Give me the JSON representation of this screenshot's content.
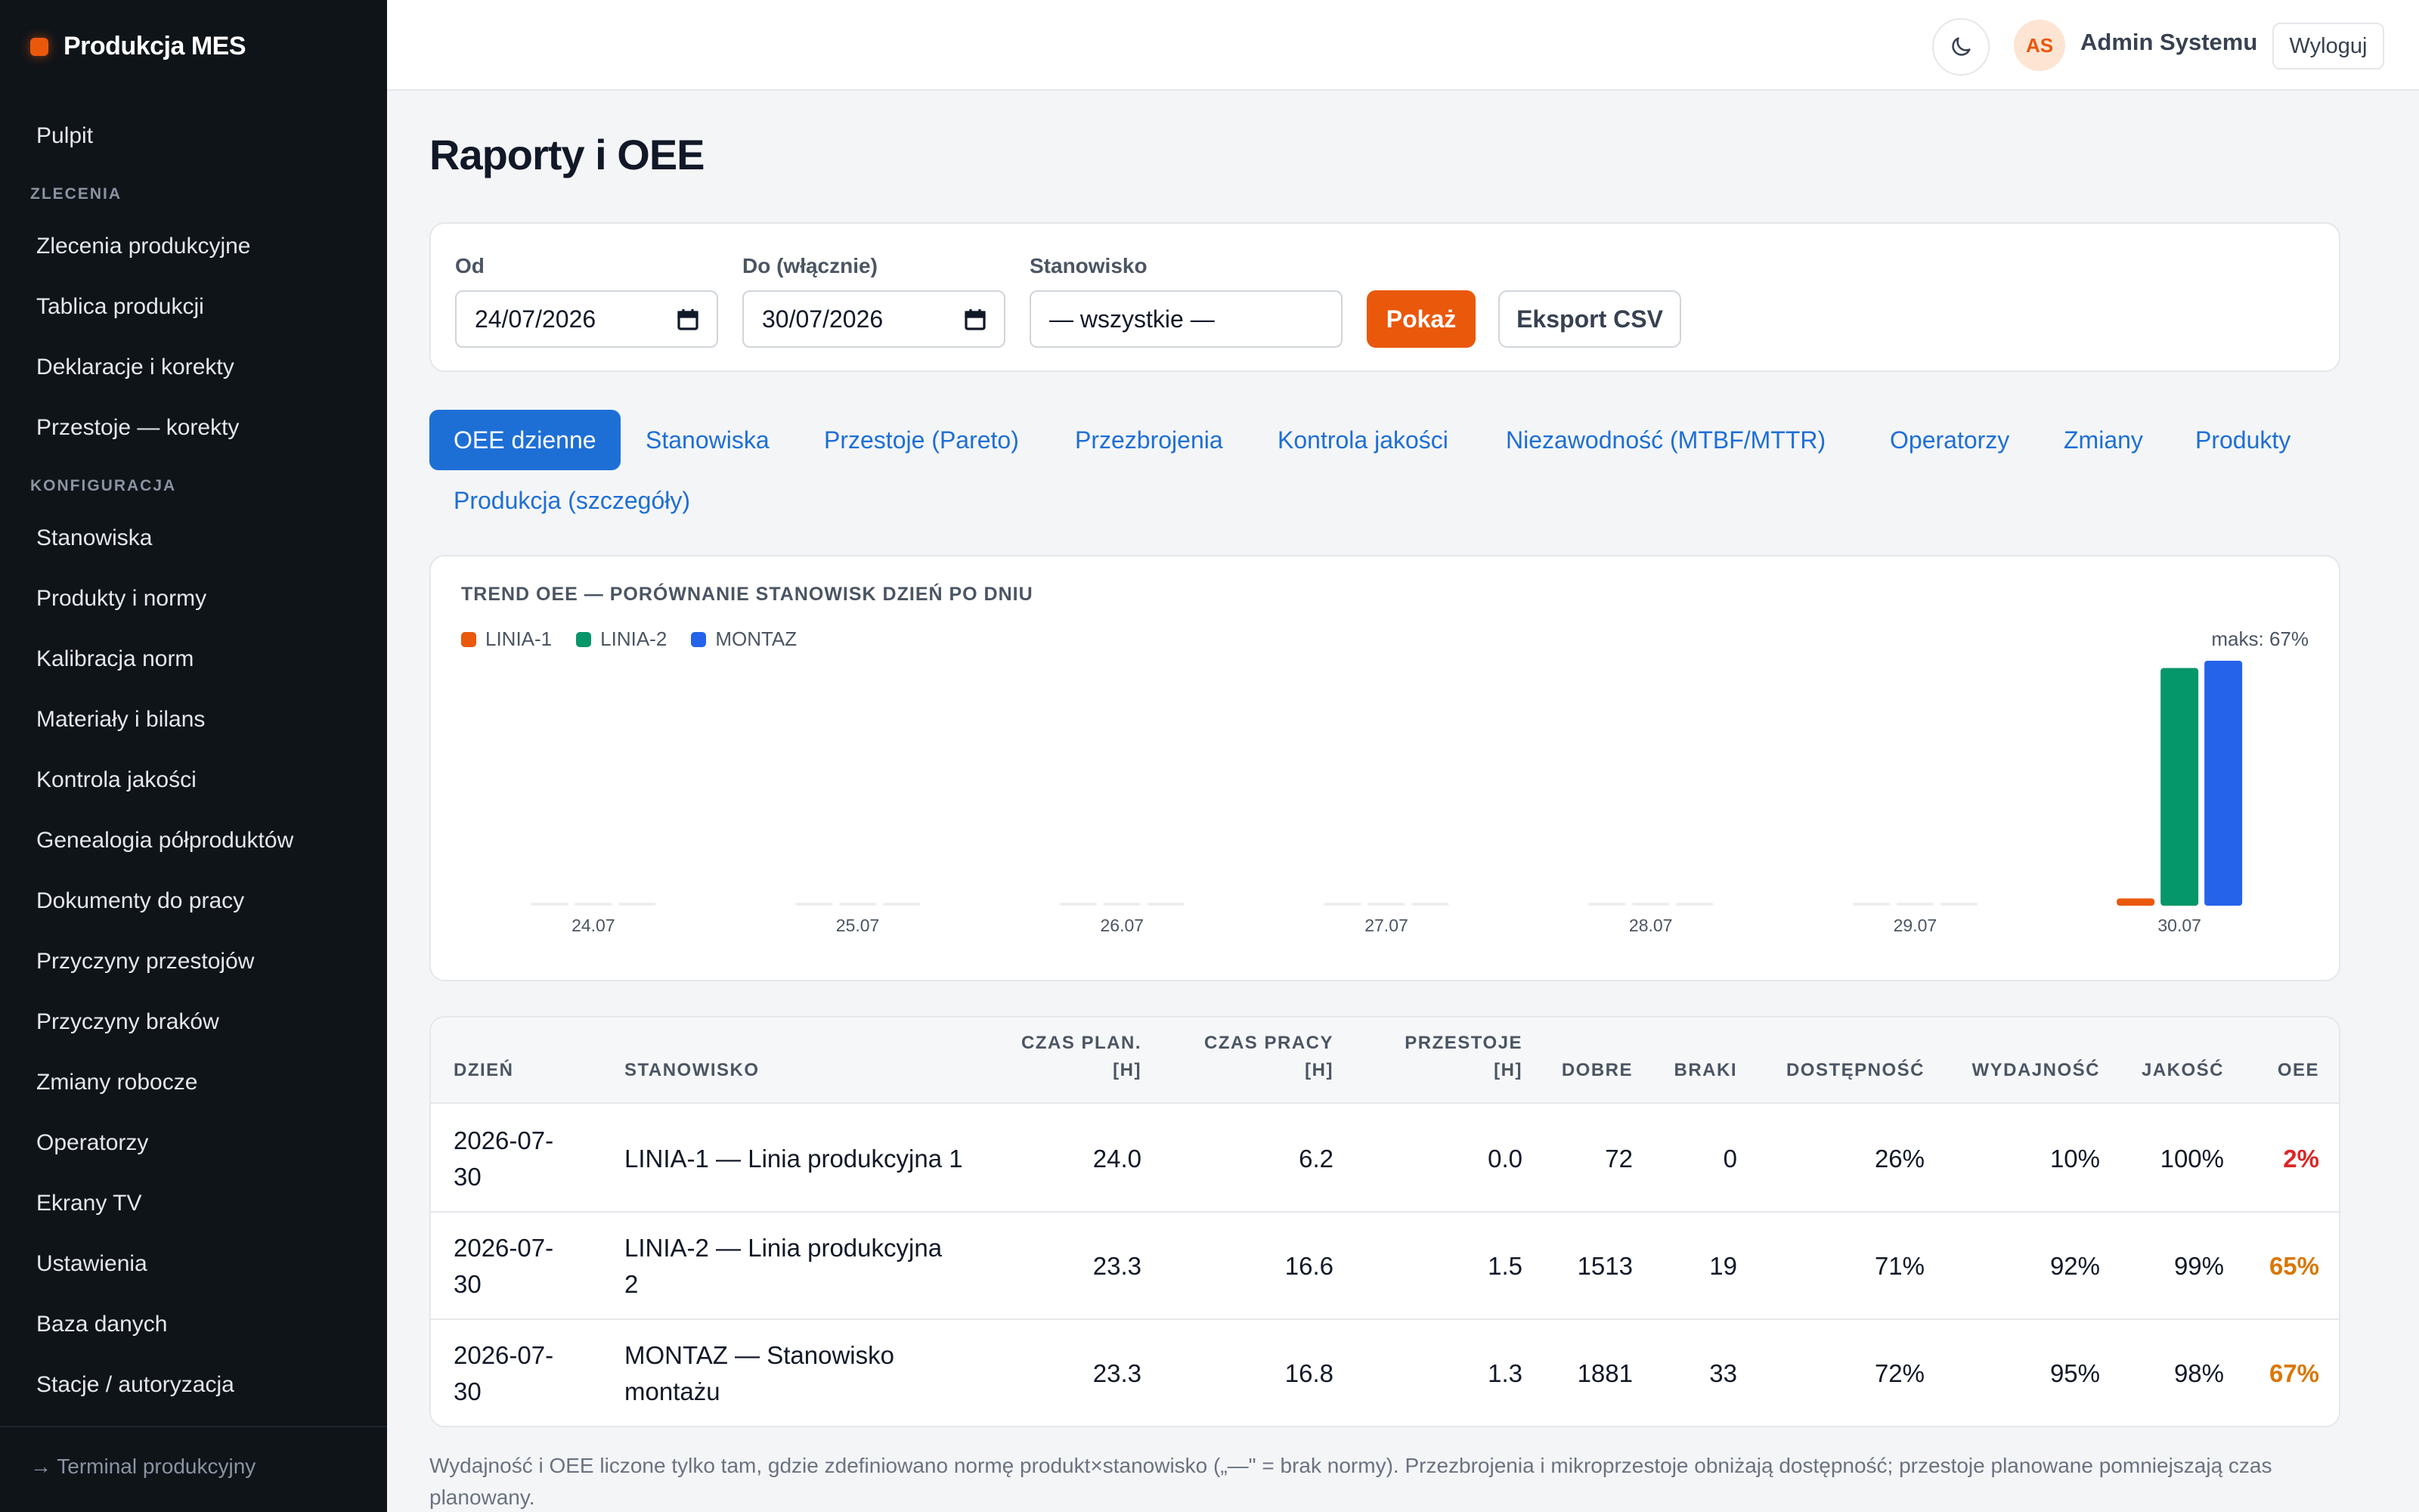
{
  "app": {
    "brand": "Produkcja MES"
  },
  "sidebar": {
    "top_item": "Pulpit",
    "section_orders": "ZLECENIA",
    "orders_items": [
      "Zlecenia produkcyjne",
      "Tablica produkcji",
      "Deklaracje i korekty",
      "Przestoje — korekty"
    ],
    "section_config": "KONFIGURACJA",
    "config_items": [
      "Stanowiska",
      "Produkty i normy",
      "Kalibracja norm",
      "Materiały i bilans",
      "Kontrola jakości",
      "Genealogia półproduktów",
      "Dokumenty do pracy",
      "Przyczyny przestojów",
      "Przyczyny braków",
      "Zmiany robocze",
      "Operatorzy",
      "Ekrany TV",
      "Ustawienia",
      "Baza danych",
      "Stacje / autoryzacja"
    ],
    "footer_link": "→ Terminal produkcyjny"
  },
  "topbar": {
    "theme_icon": "moon-icon",
    "avatar_initials": "AS",
    "user_name": "Admin Systemu",
    "logout_label": "Wyloguj"
  },
  "page": {
    "title": "Raporty i OEE"
  },
  "filters": {
    "from_label": "Od",
    "from_value": "24/07/2026",
    "to_label": "Do (włącznie)",
    "to_value": "30/07/2026",
    "station_label": "Stanowisko",
    "station_value": "— wszystkie —",
    "show_button": "Pokaż",
    "export_button": "Eksport CSV"
  },
  "tabs": [
    "OEE dzienne",
    "Stanowiska",
    "Przestoje (Pareto)",
    "Przezbrojenia",
    "Kontrola jakości",
    "Niezawodność (MTBF/MTTR)",
    "Operatorzy",
    "Zmiany",
    "Produkty",
    "Produkcja (szczegóły)"
  ],
  "active_tab": 0,
  "chart_data": {
    "type": "bar",
    "title": "TREND OEE — PORÓWNANIE STANOWISK DZIEŃ PO DNIU",
    "max_label": "maks: 67%",
    "categories": [
      "24.07",
      "25.07",
      "26.07",
      "27.07",
      "28.07",
      "29.07",
      "30.07"
    ],
    "series": [
      {
        "name": "LINIA-1",
        "color": "#ea580c",
        "values": [
          0,
          0,
          0,
          0,
          0,
          0,
          2
        ]
      },
      {
        "name": "LINIA-2",
        "color": "#059669",
        "values": [
          0,
          0,
          0,
          0,
          0,
          0,
          65
        ]
      },
      {
        "name": "MONTAZ",
        "color": "#2563eb",
        "values": [
          0,
          0,
          0,
          0,
          0,
          0,
          67
        ]
      }
    ],
    "ylim": [
      0,
      67
    ],
    "legend": "top-left",
    "grid": false
  },
  "table": {
    "headers": {
      "day": "DZIEŃ",
      "station": "STANOWISKO",
      "plan_time_1": "CZAS PLAN.",
      "plan_time_2": "[H]",
      "work_time_1": "CZAS PRACY",
      "work_time_2": "[H]",
      "downtime_1": "PRZESTOJE",
      "downtime_2": "[H]",
      "good": "DOBRE",
      "scrap": "BRAKI",
      "availability": "DOSTĘPNOŚĆ",
      "performance": "WYDAJNOŚĆ",
      "quality": "JAKOŚĆ",
      "oee": "OEE"
    },
    "rows": [
      {
        "day_1": "2026-07-",
        "day_2": "30",
        "station_1": "LINIA-1 — Linia produkcyjna 1",
        "station_2": "",
        "plan": "24.0",
        "work": "6.2",
        "down": "0.0",
        "good": "72",
        "scrap": "0",
        "avail": "26%",
        "perf": "10%",
        "qual": "100%",
        "oee": "2%",
        "oee_class": "oee-red"
      },
      {
        "day_1": "2026-07-",
        "day_2": "30",
        "station_1": "LINIA-2 — Linia produkcyjna",
        "station_2": "2",
        "plan": "23.3",
        "work": "16.6",
        "down": "1.5",
        "good": "1513",
        "scrap": "19",
        "avail": "71%",
        "perf": "92%",
        "qual": "99%",
        "oee": "65%",
        "oee_class": "oee-amber"
      },
      {
        "day_1": "2026-07-",
        "day_2": "30",
        "station_1": "MONTAZ — Stanowisko",
        "station_2": "montażu",
        "plan": "23.3",
        "work": "16.8",
        "down": "1.3",
        "good": "1881",
        "scrap": "33",
        "avail": "72%",
        "perf": "95%",
        "qual": "98%",
        "oee": "67%",
        "oee_class": "oee-amber"
      }
    ]
  },
  "footnote": "Wydajność i OEE liczone tylko tam, gdzie zdefiniowano normę produkt×stanowisko („—\" = brak normy). Przezbrojenia i mikroprzestoje obniżają dostępność; przestoje planowane pomniejszają czas planowany."
}
